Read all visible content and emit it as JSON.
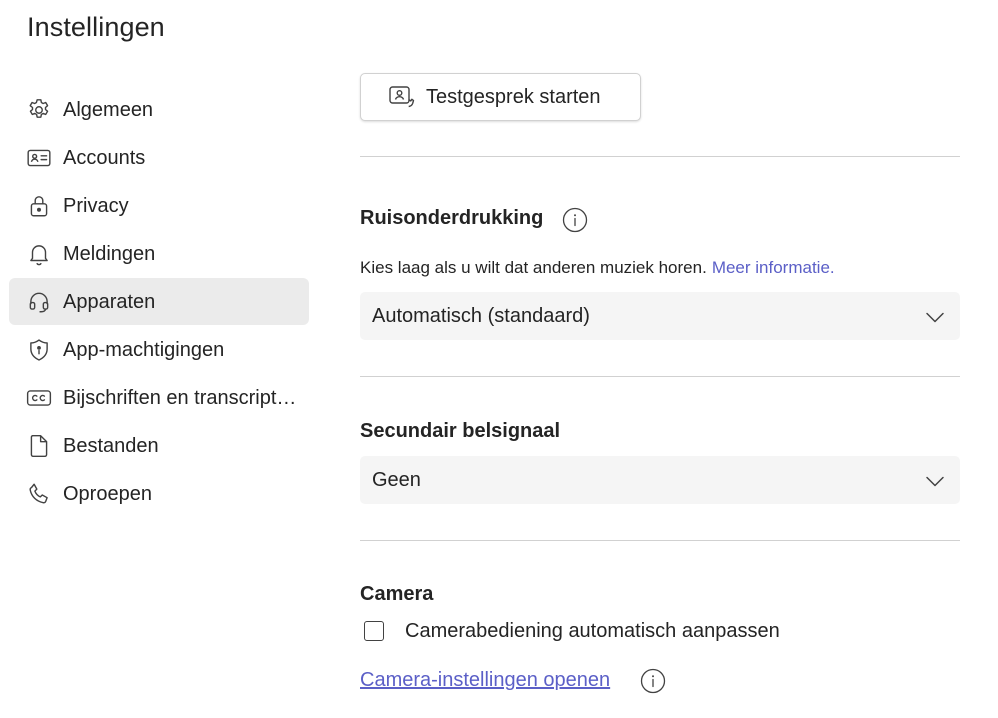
{
  "page": {
    "title": "Instellingen"
  },
  "sidebar": {
    "items": [
      {
        "label": "Algemeen",
        "icon": "gear-icon"
      },
      {
        "label": "Accounts",
        "icon": "id-card-icon"
      },
      {
        "label": "Privacy",
        "icon": "lock-icon"
      },
      {
        "label": "Meldingen",
        "icon": "bell-icon"
      },
      {
        "label": "Apparaten",
        "icon": "headset-icon",
        "active": true
      },
      {
        "label": "App-machtigingen",
        "icon": "shield-icon"
      },
      {
        "label": "Bijschriften en transcript…",
        "icon": "closed-captions-icon"
      },
      {
        "label": "Bestanden",
        "icon": "document-icon"
      },
      {
        "label": "Oproepen",
        "icon": "phone-icon"
      }
    ]
  },
  "main": {
    "test_call_button": "Testgesprek starten",
    "noise": {
      "title": "Ruisonderdrukking",
      "description": "Kies laag als u wilt dat anderen muziek horen.",
      "link": "Meer informatie.",
      "selected": "Automatisch (standaard)"
    },
    "secondary_ringer": {
      "title": "Secundair belsignaal",
      "selected": "Geen"
    },
    "camera": {
      "title": "Camera",
      "checkbox_label": "Camerabediening automatisch aanpassen",
      "checkbox_checked": false,
      "settings_link": "Camera-instellingen openen"
    }
  },
  "colors": {
    "accent": "#5b5fc7",
    "active_bg": "#ebebeb",
    "select_bg": "#f5f5f5",
    "divider": "#d1d1d1",
    "text": "#242424"
  }
}
